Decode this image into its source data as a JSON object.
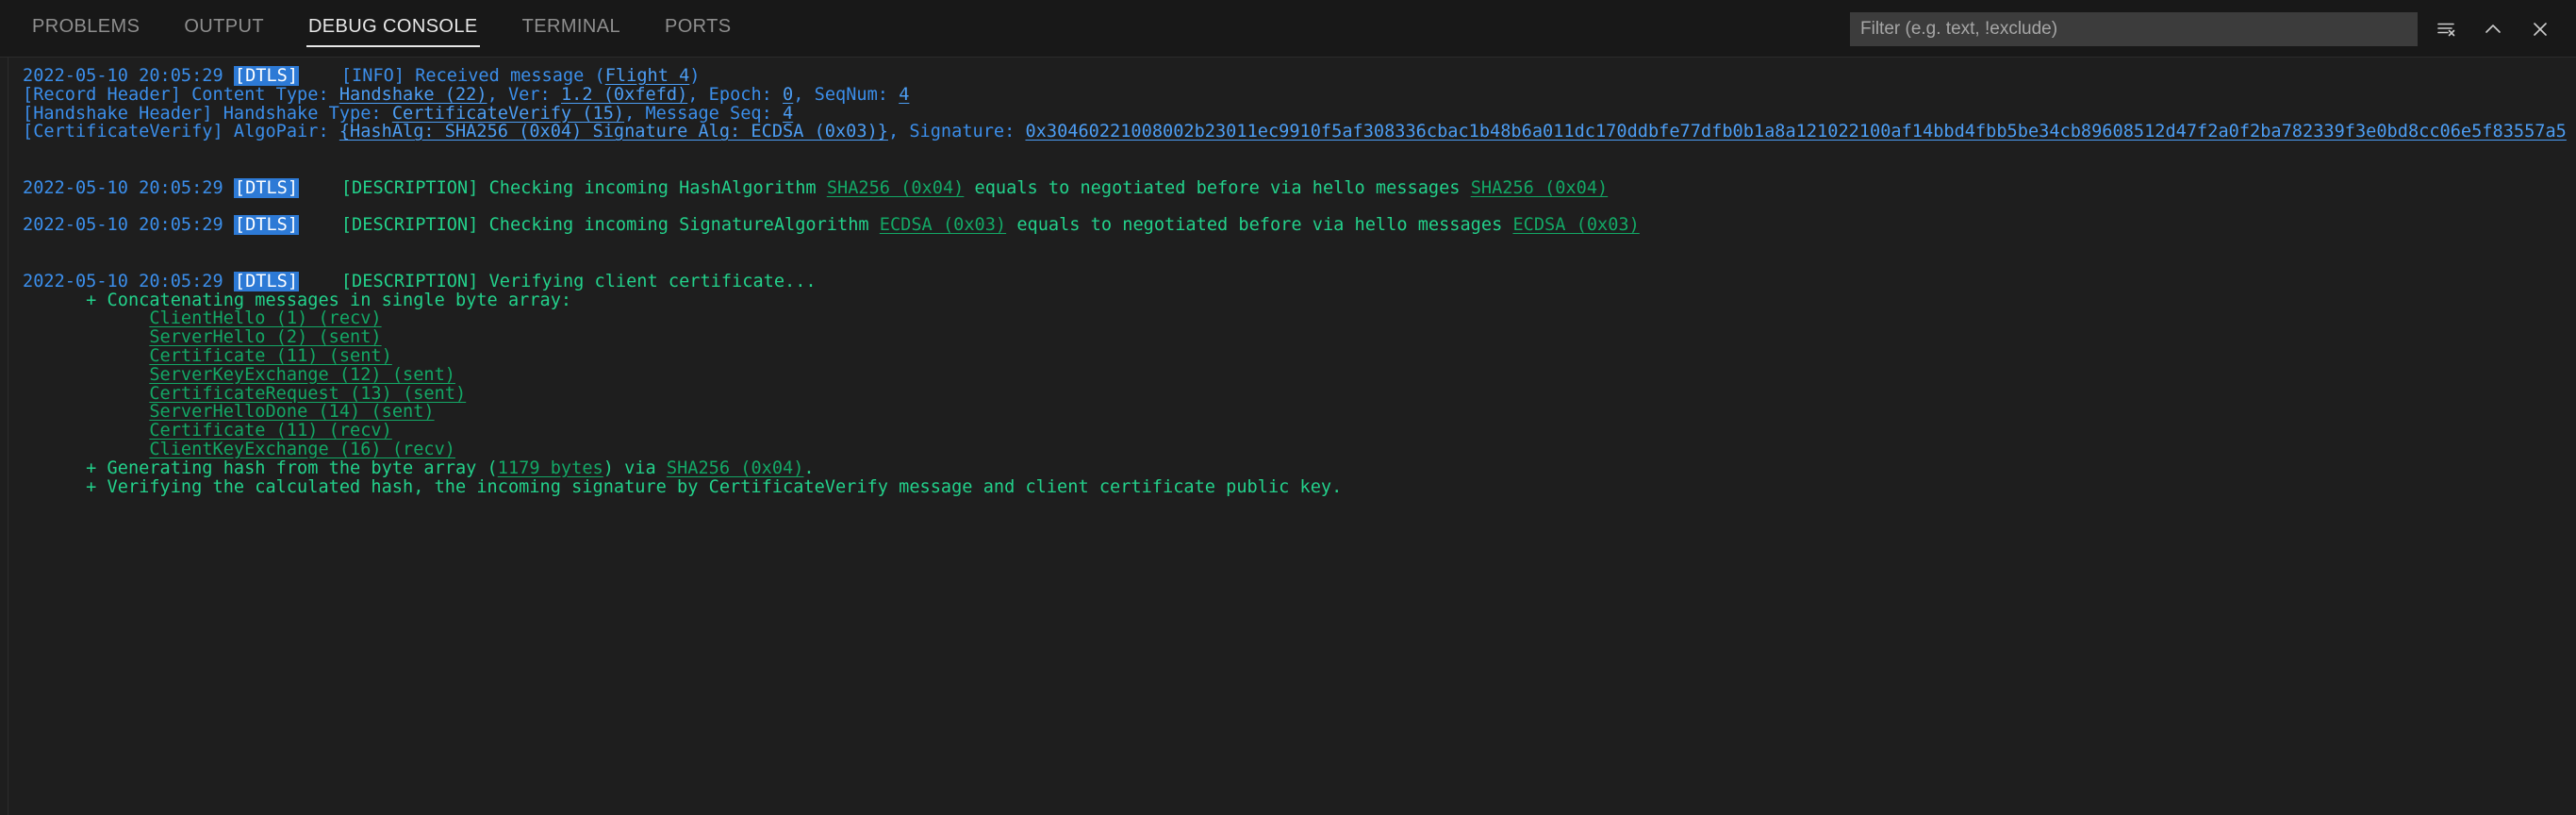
{
  "header": {
    "tabs": [
      {
        "label": "PROBLEMS",
        "active": false
      },
      {
        "label": "OUTPUT",
        "active": false
      },
      {
        "label": "DEBUG CONSOLE",
        "active": true
      },
      {
        "label": "TERMINAL",
        "active": false
      },
      {
        "label": "PORTS",
        "active": false
      }
    ],
    "filter": {
      "value": "",
      "placeholder": "Filter (e.g. text, !exclude)"
    },
    "actions": [
      {
        "name": "clear-console-button",
        "title": "Clear Console"
      },
      {
        "name": "maximize-panel-button",
        "title": "Maximize Panel Size"
      },
      {
        "name": "close-panel-button",
        "title": "Close Panel"
      }
    ]
  },
  "console": {
    "timestamp": "2022-05-10 20:05:29",
    "badge": "DTLS",
    "entries": [
      {
        "id": "entry-received-message",
        "timestamp": "2022-05-10 20:05:29",
        "badge": "DTLS",
        "level": "[INFO]",
        "segments": [
          {
            "t": "[INFO] Received message (",
            "k": "blue"
          },
          {
            "t": "Flight 4",
            "k": "link-blue"
          },
          {
            "t": ")",
            "k": "blue"
          }
        ],
        "continuations": [
          [
            {
              "t": "[Record Header] Content Type: ",
              "k": "blue"
            },
            {
              "t": "Handshake (22)",
              "k": "link-blue"
            },
            {
              "t": ", Ver: ",
              "k": "blue"
            },
            {
              "t": "1.2 (0xfefd)",
              "k": "link-blue"
            },
            {
              "t": ", Epoch: ",
              "k": "blue"
            },
            {
              "t": "0",
              "k": "link-blue"
            },
            {
              "t": ", SeqNum: ",
              "k": "blue"
            },
            {
              "t": "4",
              "k": "link-blue"
            }
          ],
          [
            {
              "t": "[Handshake Header] Handshake Type: ",
              "k": "blue"
            },
            {
              "t": "CertificateVerify (15)",
              "k": "link-blue"
            },
            {
              "t": ", Message Seq: ",
              "k": "blue"
            },
            {
              "t": "4",
              "k": "link-blue"
            }
          ],
          [
            {
              "t": "[CertificateVerify] AlgoPair: ",
              "k": "blue"
            },
            {
              "t": "{HashAlg: SHA256 (0x04) Signature Alg: ECDSA (0x03)}",
              "k": "link-blue"
            },
            {
              "t": ", Signature: ",
              "k": "blue"
            },
            {
              "t": "0x30460221008002b23011ec9910f5af308336cbac1b48b6a011dc170ddbfe77dfb0b1a8a121022100af14bbd4fbb5be34cb89608512d47f2a0f2ba782339f3e0bd8cc06e5f83557a5",
              "k": "link-blue"
            }
          ]
        ]
      },
      {
        "id": "entry-check-hashalgorithm",
        "timestamp": "2022-05-10 20:05:29",
        "badge": "DTLS",
        "level": "[DESCRIPTION]",
        "segments": [
          {
            "t": "[DESCRIPTION] Checking incoming HashAlgorithm ",
            "k": "green"
          },
          {
            "t": "SHA256 (0x04)",
            "k": "link-green"
          },
          {
            "t": " equals to negotiated before via hello messages ",
            "k": "green"
          },
          {
            "t": "SHA256 (0x04)",
            "k": "link-green"
          }
        ],
        "continuations": []
      },
      {
        "id": "entry-check-signaturealgorithm",
        "timestamp": "2022-05-10 20:05:29",
        "badge": "DTLS",
        "level": "[DESCRIPTION]",
        "segments": [
          {
            "t": "[DESCRIPTION] Checking incoming SignatureAlgorithm ",
            "k": "green"
          },
          {
            "t": "ECDSA (0x03)",
            "k": "link-green"
          },
          {
            "t": " equals to negotiated before via hello messages ",
            "k": "green"
          },
          {
            "t": "ECDSA (0x03)",
            "k": "link-green"
          }
        ],
        "continuations": []
      },
      {
        "id": "entry-verifying-client-certificate",
        "timestamp": "2022-05-10 20:05:29",
        "badge": "DTLS",
        "level": "[DESCRIPTION]",
        "segments": [
          {
            "t": "[DESCRIPTION] Verifying client certificate...",
            "k": "green"
          }
        ],
        "continuations": [
          [
            {
              "t": "      + Concatenating messages in single byte array:",
              "k": "green"
            }
          ],
          [
            {
              "t": "            ",
              "k": "gap"
            },
            {
              "t": "ClientHello (1) (recv)",
              "k": "link-green"
            }
          ],
          [
            {
              "t": "            ",
              "k": "gap"
            },
            {
              "t": "ServerHello (2) (sent)",
              "k": "link-green"
            }
          ],
          [
            {
              "t": "            ",
              "k": "gap"
            },
            {
              "t": "Certificate (11) (sent)",
              "k": "link-green"
            }
          ],
          [
            {
              "t": "            ",
              "k": "gap"
            },
            {
              "t": "ServerKeyExchange (12) (sent)",
              "k": "link-green"
            }
          ],
          [
            {
              "t": "            ",
              "k": "gap"
            },
            {
              "t": "CertificateRequest (13) (sent)",
              "k": "link-green"
            }
          ],
          [
            {
              "t": "            ",
              "k": "gap"
            },
            {
              "t": "ServerHelloDone (14) (sent)",
              "k": "link-green"
            }
          ],
          [
            {
              "t": "            ",
              "k": "gap"
            },
            {
              "t": "Certificate (11) (recv)",
              "k": "link-green"
            }
          ],
          [
            {
              "t": "            ",
              "k": "gap"
            },
            {
              "t": "ClientKeyExchange (16) (recv)",
              "k": "link-green"
            }
          ],
          [
            {
              "t": "      + Generating hash from the byte array (",
              "k": "green"
            },
            {
              "t": "1179 bytes",
              "k": "link-green"
            },
            {
              "t": ") via ",
              "k": "green"
            },
            {
              "t": "SHA256 (0x04)",
              "k": "link-green"
            },
            {
              "t": ".",
              "k": "green"
            }
          ],
          [
            {
              "t": "      + Verifying the calculated hash, the incoming signature by CertificateVerify message and client certificate public key.",
              "k": "green"
            }
          ]
        ]
      }
    ]
  }
}
